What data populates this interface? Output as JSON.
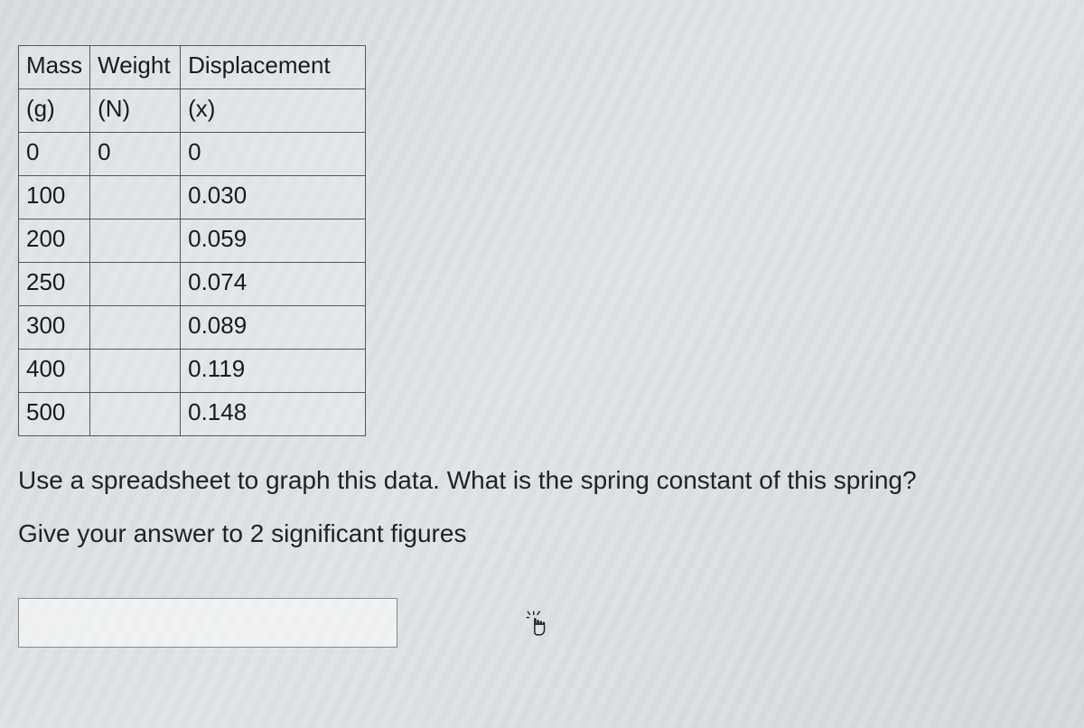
{
  "table": {
    "headers": {
      "mass_label": "Mass",
      "mass_unit": "(g)",
      "weight_label": "Weight",
      "weight_unit": "(N)",
      "disp_label": "Displacement",
      "disp_unit": "(x)"
    },
    "rows": [
      {
        "mass": "0",
        "weight": "0",
        "disp": "0"
      },
      {
        "mass": "100",
        "weight": "",
        "disp": "0.030"
      },
      {
        "mass": "200",
        "weight": "",
        "disp": "0.059"
      },
      {
        "mass": "250",
        "weight": "",
        "disp": "0.074"
      },
      {
        "mass": "300",
        "weight": "",
        "disp": "0.089"
      },
      {
        "mass": "400",
        "weight": "",
        "disp": "0.119"
      },
      {
        "mass": "500",
        "weight": "",
        "disp": "0.148"
      }
    ]
  },
  "question_text": "Use a spreadsheet to graph this data. What is the spring constant of this spring?",
  "instruction_text": "Give your answer to 2 significant figures",
  "answer_value": ""
}
